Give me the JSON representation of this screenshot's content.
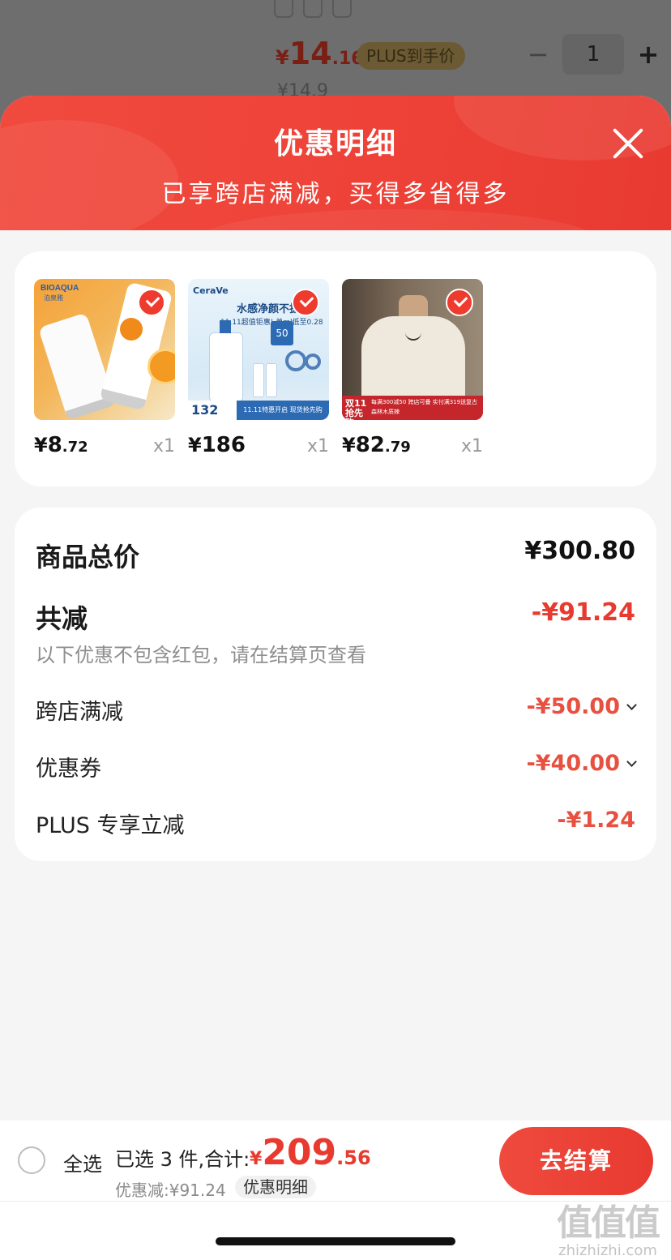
{
  "background_page": {
    "tags": [
      "",
      "",
      ""
    ],
    "price_symbol": "¥",
    "price_int": "14",
    "price_dec": ".16",
    "plus_label": "PLUS到手价",
    "orig_price": "¥14.9",
    "quantity": "1",
    "minus": "−",
    "plus": "+"
  },
  "sheet": {
    "title": "优惠明细",
    "subtitle": "已享跨店满减，买得多省得多"
  },
  "products": [
    {
      "price_symbol": "¥",
      "price_int": "8",
      "price_dec": ".72",
      "qty": "x1",
      "checked": true,
      "image": {
        "brand": "BIOAQUA",
        "brand_sub": "泊泉雅"
      }
    },
    {
      "price_symbol": "¥",
      "price_int": "186",
      "price_dec": "",
      "qty": "x1",
      "checked": true,
      "image": {
        "logo": "CeraVe",
        "headline": "水感净颜不拔干",
        "sub": "11.11超值钜惠! 单ml低至0.28元",
        "badge": "50",
        "tag_price": "132",
        "tag_text": "11.11特惠开启 现货抢先购"
      }
    },
    {
      "price_symbol": "¥",
      "price_int": "82",
      "price_dec": ".79",
      "qty": "x1",
      "checked": true,
      "image": {
        "banner_left": "双11 抢先购",
        "banner_right": "每满300减50 跨店可叠 实付满319送复古森林木质辣"
      }
    }
  ],
  "summary": {
    "total_label": "商品总价",
    "total_value": "¥300.80",
    "reduce_label": "共减",
    "reduce_value": "-¥91.24",
    "note": "以下优惠不包含红包，请在结算页查看",
    "items": [
      {
        "label": "跨店满减",
        "value": "-¥50.00",
        "expandable": true
      },
      {
        "label": "优惠券",
        "value": "-¥40.00",
        "expandable": true
      },
      {
        "label": "PLUS 专享立减",
        "value": "-¥1.24",
        "expandable": false
      }
    ]
  },
  "bottom_bar": {
    "select_all": "全选",
    "selected_info": "已选 3 件,合计:",
    "grand_symbol": "¥",
    "grand_int": "209",
    "grand_dec": ".56",
    "discount_line": "优惠减:¥91.24",
    "detail_label": "优惠明细",
    "checkout_label": "去结算"
  },
  "watermark": {
    "big": "值值值",
    "small": "zhizhizhi.com"
  },
  "colors": {
    "accent": "#E83A2E",
    "header_bg": "#EE4238",
    "sheet_bg": "#F5F5F5"
  }
}
